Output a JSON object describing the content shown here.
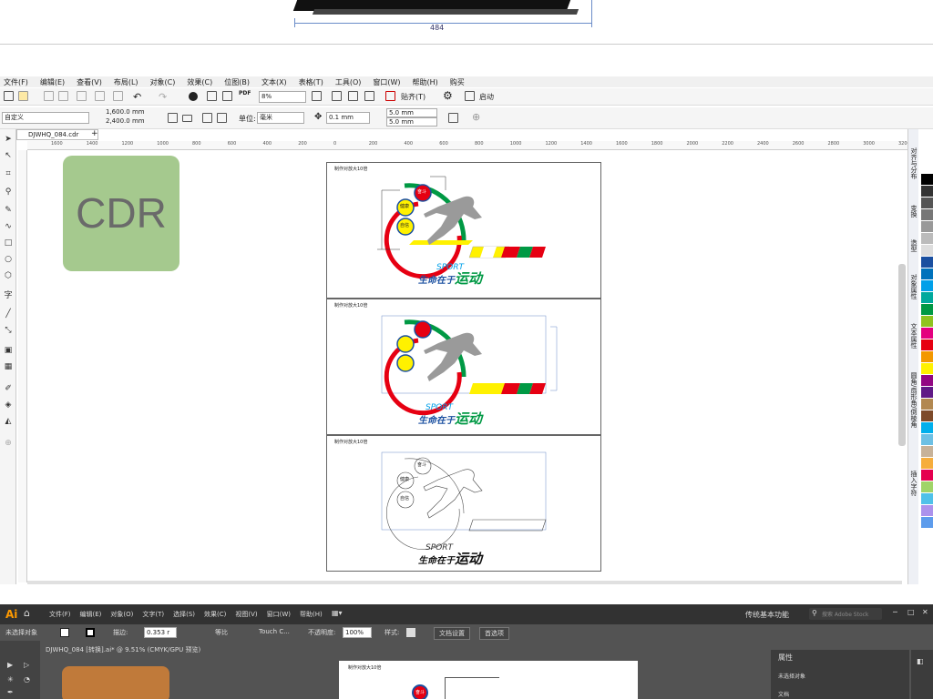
{
  "top_drawing": {
    "dimension": "484"
  },
  "cdr": {
    "menus": [
      "文件(F)",
      "编辑(E)",
      "查看(V)",
      "布局(L)",
      "对象(C)",
      "效果(C)",
      "位图(B)",
      "文本(X)",
      "表格(T)",
      "工具(O)",
      "窗口(W)",
      "帮助(H)",
      "购买"
    ],
    "zoom": "8%",
    "snap_label": "贴齐(T)",
    "launch_label": "启动",
    "preset": "自定义",
    "width": "1,600.0 mm",
    "height": "2,400.0 mm",
    "unit_label": "单位:",
    "unit": "毫米",
    "nudge": "0.1 mm",
    "dup_x": "5.0 mm",
    "dup_y": "5.0 mm",
    "tab_title": "DJWHQ_084.cdr",
    "ruler_ticks": [
      "1600",
      "1400",
      "1200",
      "1000",
      "800",
      "600",
      "400",
      "200",
      "0",
      "200",
      "400",
      "600",
      "800",
      "1000",
      "1200",
      "1400",
      "1600",
      "1800",
      "2000",
      "2200",
      "2400",
      "2600",
      "2800",
      "3000",
      "3200"
    ],
    "badge_text": "CDR",
    "page_note": "制作对放大10倍",
    "circle_labels": [
      "奋斗",
      "健康",
      "自信"
    ],
    "sport": "SPORT",
    "slogan_a": "生命在于",
    "slogan_b": "运动",
    "right_tabs": [
      "对齐与分布",
      "变换",
      "造型",
      "对象属性",
      "文本属性",
      "圆角/扇形角/倒棱角",
      "插入字符"
    ],
    "palette": [
      "#ffffff",
      "#000000",
      "#333333",
      "#555555",
      "#777777",
      "#999999",
      "#bbbbbb",
      "#dddddd",
      "#1a4fa0",
      "#0072bc",
      "#00a0e9",
      "#00a99d",
      "#009944",
      "#8fc31f",
      "#e4007f",
      "#e60012",
      "#f39800",
      "#fff100",
      "#920783",
      "#601986",
      "#b28850",
      "#7d4a2a",
      "#00afec",
      "#6dc0e4",
      "#c7b299",
      "#f6ad3c",
      "#e5004f",
      "#a0d468",
      "#4fc1e9",
      "#ac92ec",
      "#5d9cec"
    ],
    "colors": {
      "badge_bg": "#a5c98e",
      "red": "#e60012",
      "green": "#009944",
      "yellow": "#fff100",
      "blue": "#0072bc"
    }
  },
  "ai": {
    "logo": "Ai",
    "menus": [
      "文件(F)",
      "编辑(E)",
      "对象(O)",
      "文字(T)",
      "选择(S)",
      "效果(C)",
      "视图(V)",
      "窗口(W)",
      "帮助(H)"
    ],
    "workspace": "传统基本功能",
    "search_placeholder": "搜索 Adobe Stock",
    "no_selection": "未选择对象",
    "stroke_label": "描边:",
    "stroke_value": "0.353 r",
    "profile": "等比",
    "brush": "Touch C...",
    "opacity_label": "不透明度:",
    "opacity": "100%",
    "style_label": "样式:",
    "doc_settings": "文档设置",
    "prefs": "首选项",
    "tab_title": "DJWHQ_084 [转换].ai* @ 9.51% (CMYK/GPU 预览)",
    "panel_title": "属性",
    "panel_none": "未选择对象",
    "panel_doc": "文档",
    "artboard_note": "制作对放大10倍",
    "circle_label": "奋斗"
  }
}
